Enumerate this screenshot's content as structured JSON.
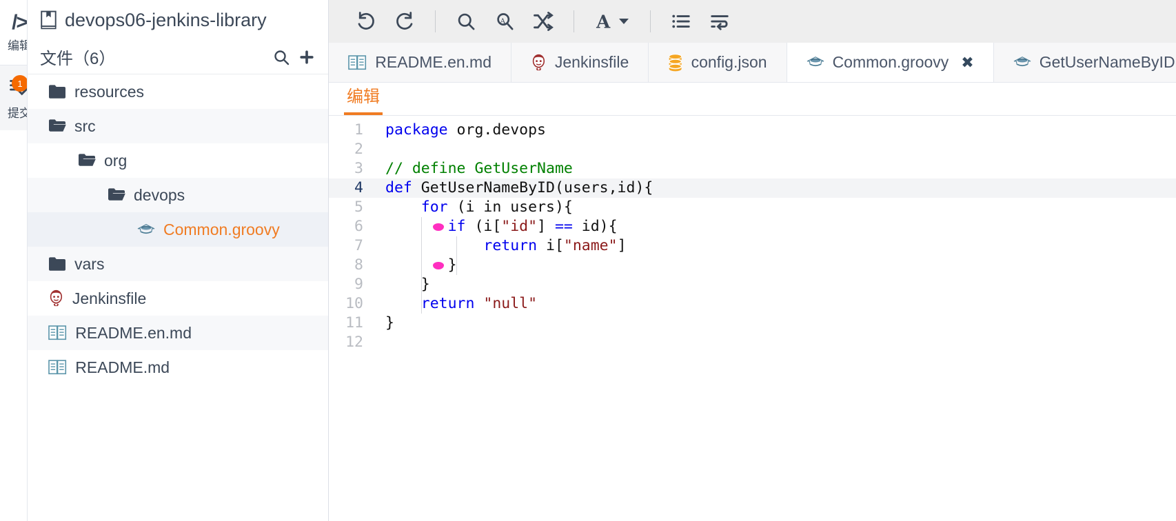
{
  "rail": {
    "items": [
      {
        "name": "code-icon",
        "glyph": "/>",
        "label": "编辑",
        "badge": "",
        "active": false
      },
      {
        "name": "commit-icon",
        "glyph": "☰",
        "label": "提交",
        "badge": "1",
        "active": true
      }
    ]
  },
  "sidebar": {
    "repo": {
      "icon": "repository-icon",
      "title": "devops06-jenkins-library"
    },
    "files_header": {
      "title": "文件（6）",
      "search_icon": "search-icon",
      "add_icon": "plus-icon"
    },
    "tree": [
      {
        "label": "resources",
        "icon": "folder-closed-icon",
        "indent": 0,
        "selected": false
      },
      {
        "label": "src",
        "icon": "folder-open-icon",
        "indent": 0,
        "selected": false
      },
      {
        "label": "org",
        "icon": "folder-open-icon",
        "indent": 1,
        "selected": false
      },
      {
        "label": "devops",
        "icon": "folder-open-icon",
        "indent": 2,
        "selected": false
      },
      {
        "label": "Common.groovy",
        "icon": "groovy-icon",
        "indent": 3,
        "selected": true
      },
      {
        "label": "vars",
        "icon": "folder-closed-icon",
        "indent": 0,
        "selected": false
      },
      {
        "label": "Jenkinsfile",
        "icon": "jenkins-icon",
        "indent": 0,
        "selected": false
      },
      {
        "label": "README.en.md",
        "icon": "markdown-book-icon",
        "indent": 0,
        "selected": false
      },
      {
        "label": "README.md",
        "icon": "markdown-book-icon",
        "indent": 0,
        "selected": false
      }
    ]
  },
  "toolbar": {
    "buttons": [
      {
        "name": "undo-button",
        "title": "撤销"
      },
      {
        "name": "redo-button",
        "title": "重做"
      },
      {
        "name": "find-button",
        "title": "查找"
      },
      {
        "name": "find-replace-button",
        "title": "查找替换"
      },
      {
        "name": "shuffle-button",
        "title": "跳转"
      },
      {
        "name": "font-button",
        "title": "字体",
        "caret": "▾"
      },
      {
        "name": "list-button",
        "title": "列表"
      },
      {
        "name": "wrap-button",
        "title": "自动换行"
      }
    ]
  },
  "tabs": [
    {
      "label": "README.en.md",
      "icon": "markdown-book-icon",
      "active": false,
      "closable": false
    },
    {
      "label": "Jenkinsfile",
      "icon": "jenkins-icon",
      "active": false,
      "closable": false
    },
    {
      "label": "config.json",
      "icon": "database-icon",
      "active": false,
      "closable": false
    },
    {
      "label": "Common.groovy",
      "icon": "groovy-icon",
      "active": true,
      "closable": true,
      "close_label": "✖"
    },
    {
      "label": "GetUserNameByID.groovy",
      "icon": "groovy-icon",
      "active": false,
      "closable": false
    }
  ],
  "editor_tabs": [
    {
      "label": "编辑",
      "active": true
    }
  ],
  "code": {
    "active_line": 4,
    "lines": [
      {
        "n": "1",
        "tokens": [
          {
            "t": "package",
            "c": "k"
          },
          {
            "t": " org.devops",
            "c": "pl"
          }
        ]
      },
      {
        "n": "2",
        "tokens": []
      },
      {
        "n": "3",
        "tokens": [
          {
            "t": "// define GetUserName",
            "c": "cm"
          }
        ]
      },
      {
        "n": "4",
        "tokens": [
          {
            "t": "def",
            "c": "k"
          },
          {
            "t": " GetUserNameByID(users,id){",
            "c": "pl"
          }
        ]
      },
      {
        "n": "5",
        "tokens": [
          {
            "t": "    ",
            "c": "pl"
          },
          {
            "t": "for",
            "c": "k"
          },
          {
            "t": " (i in users){",
            "c": "pl"
          }
        ]
      },
      {
        "n": "6",
        "tokens": [
          {
            "t": "       ",
            "c": "pl"
          },
          {
            "t": "if",
            "c": "k"
          },
          {
            "t": " (i[",
            "c": "pl"
          },
          {
            "t": "\"id\"",
            "c": "st"
          },
          {
            "t": "] ",
            "c": "pl"
          },
          {
            "t": "==",
            "c": "op"
          },
          {
            "t": " id){",
            "c": "pl"
          }
        ]
      },
      {
        "n": "7",
        "tokens": [
          {
            "t": "           ",
            "c": "pl"
          },
          {
            "t": "return",
            "c": "k"
          },
          {
            "t": " i[",
            "c": "pl"
          },
          {
            "t": "\"name\"",
            "c": "st"
          },
          {
            "t": "]",
            "c": "pl"
          }
        ]
      },
      {
        "n": "8",
        "tokens": [
          {
            "t": "       }",
            "c": "pl"
          }
        ]
      },
      {
        "n": "9",
        "tokens": [
          {
            "t": "    }",
            "c": "pl"
          }
        ]
      },
      {
        "n": "10",
        "tokens": [
          {
            "t": "    ",
            "c": "pl"
          },
          {
            "t": "return",
            "c": "k"
          },
          {
            "t": " ",
            "c": "pl"
          },
          {
            "t": "\"null\"",
            "c": "st"
          }
        ]
      },
      {
        "n": "11",
        "tokens": [
          {
            "t": "}",
            "c": "pl"
          }
        ]
      },
      {
        "n": "12",
        "tokens": []
      }
    ]
  },
  "colors": {
    "accent_orange": "#f07c23",
    "badge_orange": "#f56a00",
    "text_dark": "#3c4858",
    "keyword_blue": "#0000ee",
    "string_red": "#8b1a1a",
    "comment_green": "#008000",
    "fold_marker_pink": "#ff2fc0",
    "selected_row": "#eef1f6"
  }
}
